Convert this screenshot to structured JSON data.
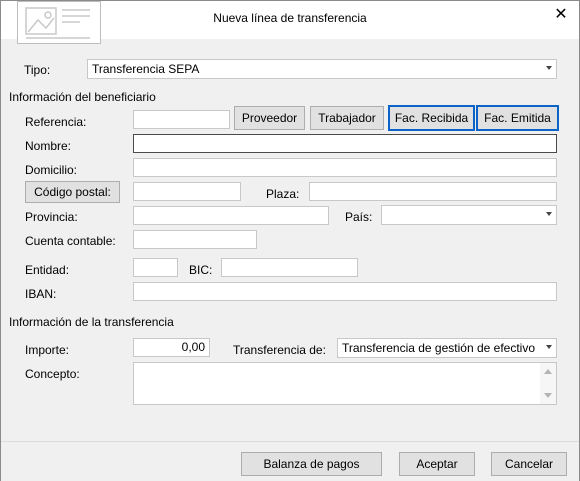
{
  "window": {
    "title": "Nueva línea de transferencia",
    "close_symbol": "✕"
  },
  "tipo": {
    "label": "Tipo:",
    "value": "Transferencia SEPA"
  },
  "beneficiario": {
    "section_title": "Información del beneficiario",
    "referencia_label": "Referencia:",
    "referencia_value": "",
    "buttons": {
      "proveedor": "Proveedor",
      "trabajador": "Trabajador",
      "fac_recibida": "Fac. Recibida",
      "fac_emitida": "Fac. Emitida"
    },
    "nombre_label": "Nombre:",
    "nombre_value": "",
    "domicilio_label": "Domicilio:",
    "domicilio_value": "",
    "codigo_postal_button": "Código postal:",
    "codigo_postal_value": "",
    "plaza_label": "Plaza:",
    "plaza_value": "",
    "provincia_label": "Provincia:",
    "provincia_value": "",
    "pais_label": "País:",
    "pais_value": "",
    "cuenta_label": "Cuenta contable:",
    "cuenta_value": "",
    "entidad_label": "Entidad:",
    "entidad_value": "",
    "bic_label": "BIC:",
    "bic_value": "",
    "iban_label": "IBAN:",
    "iban_value": ""
  },
  "transferencia": {
    "section_title": "Información de la transferencia",
    "importe_label": "Importe:",
    "importe_value": "0,00",
    "transferencia_de_label": "Transferencia de:",
    "transferencia_de_value": "Transferencia de gestión de efectivo",
    "concepto_label": "Concepto:",
    "concepto_value": ""
  },
  "footer": {
    "balanza": "Balanza de pagos",
    "aceptar": "Aceptar",
    "cancelar": "Cancelar"
  },
  "colors": {
    "accent_border": "#0a64c8",
    "window_bg": "#f0f0f0"
  }
}
